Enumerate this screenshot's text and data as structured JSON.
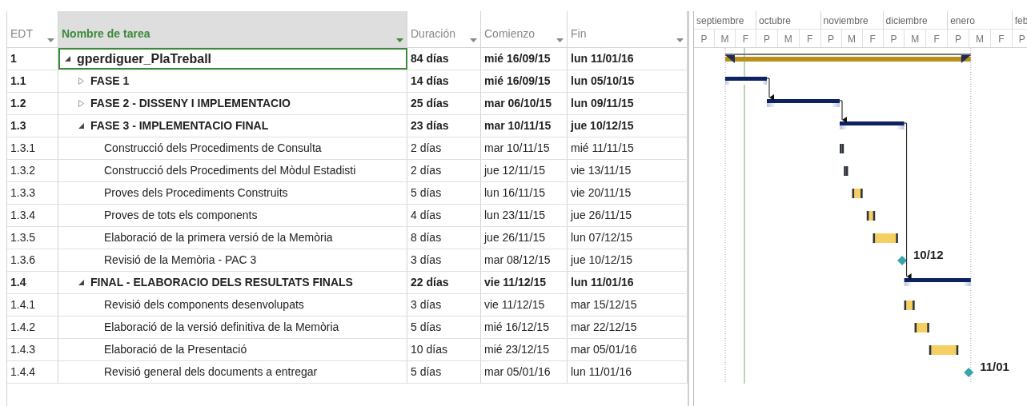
{
  "columns": [
    {
      "label": "EDT",
      "selected": false
    },
    {
      "label": "Nombre de tarea",
      "selected": true
    },
    {
      "label": "Duración",
      "selected": false
    },
    {
      "label": "Comienzo",
      "selected": false
    },
    {
      "label": "Fin",
      "selected": false
    }
  ],
  "timescale": {
    "months": [
      {
        "label": "septiembre",
        "periods": [
          "P",
          "M",
          "F"
        ]
      },
      {
        "label": "octubre",
        "periods": [
          "P",
          "M",
          "F"
        ]
      },
      {
        "label": "noviembre",
        "periods": [
          "P",
          "M",
          "F"
        ]
      },
      {
        "label": "diciembre",
        "periods": [
          "P",
          "M",
          "F"
        ]
      },
      {
        "label": "enero",
        "periods": [
          "P",
          "M",
          "F"
        ]
      },
      {
        "label": "feb",
        "periods": [
          "P"
        ]
      }
    ]
  },
  "tasks": [
    {
      "edt": "1",
      "name": "gperdiguer_PlaTreball",
      "duration": "84 días",
      "start": "mié 16/09/15",
      "finish": "lun 11/01/16",
      "kind": "project",
      "expanded": true,
      "selected": true,
      "children": [
        {
          "edt": "1.1",
          "name": "FASE 1",
          "duration": "14 días",
          "start": "mié 16/09/15",
          "finish": "lun 05/10/15",
          "kind": "summary",
          "expanded": false,
          "selected": false,
          "links_to_next": true
        },
        {
          "edt": "1.2",
          "name": "FASE 2 - DISSENY I IMPLEMENTACIO",
          "duration": "25 días",
          "start": "mar 06/10/15",
          "finish": "lun 09/11/15",
          "kind": "summary",
          "expanded": false,
          "selected": false,
          "links_to_next": true
        },
        {
          "edt": "1.3",
          "name": "FASE 3 - IMPLEMENTACIO FINAL",
          "duration": "23 días",
          "start": "mar 10/11/15",
          "finish": "jue 10/12/15",
          "kind": "summary",
          "expanded": true,
          "selected": false,
          "links_to_next": true,
          "children": [
            {
              "edt": "1.3.1",
              "name": "Construcció dels Procediments de Consulta",
              "duration": "2 días",
              "start": "mar 10/11/15",
              "finish": "mié 11/11/15",
              "kind": "task",
              "selected": false
            },
            {
              "edt": "1.3.2",
              "name": "Construcció dels Procediments del Mòdul Estadisti",
              "duration": "2 días",
              "start": "jue 12/11/15",
              "finish": "vie 13/11/15",
              "kind": "task",
              "selected": false
            },
            {
              "edt": "1.3.3",
              "name": "Proves dels Procediments Construits",
              "duration": "5 días",
              "start": "lun 16/11/15",
              "finish": "vie 20/11/15",
              "kind": "task",
              "selected": false
            },
            {
              "edt": "1.3.4",
              "name": "Proves de tots els components",
              "duration": "4 días",
              "start": "lun 23/11/15",
              "finish": "jue 26/11/15",
              "kind": "task",
              "selected": false
            },
            {
              "edt": "1.3.5",
              "name": "Elaboració de la primera versió de la Memòria",
              "duration": "8 días",
              "start": "jue 26/11/15",
              "finish": "lun 07/12/15",
              "kind": "task",
              "selected": false
            },
            {
              "edt": "1.3.6",
              "name": "Revisió de la Memòria - PAC 3",
              "duration": "3 días",
              "start": "mar 08/12/15",
              "finish": "jue 10/12/15",
              "kind": "milestone",
              "bar_label": "10/12",
              "selected": false
            }
          ]
        },
        {
          "edt": "1.4",
          "name": "FINAL - ELABORACIO DELS RESULTATS FINALS",
          "duration": "22 días",
          "start": "vie 11/12/15",
          "finish": "lun 11/01/16",
          "kind": "summary",
          "expanded": true,
          "selected": false,
          "children": [
            {
              "edt": "1.4.1",
              "name": "Revisió dels components desenvolupats",
              "duration": "3 días",
              "start": "vie 11/12/15",
              "finish": "mar 15/12/15",
              "kind": "task",
              "selected": false
            },
            {
              "edt": "1.4.2",
              "name": "Elaboració de la versió definitiva de la Memòria",
              "duration": "5 días",
              "start": "mié 16/12/15",
              "finish": "mar 22/12/15",
              "kind": "task",
              "selected": false
            },
            {
              "edt": "1.4.3",
              "name": "Elaboració de la Presentació",
              "duration": "10 días",
              "start": "mié 23/12/15",
              "finish": "mar 05/01/16",
              "kind": "task",
              "selected": false
            },
            {
              "edt": "1.4.4",
              "name": "Revisió general dels documents a entregar",
              "duration": "5 días",
              "start": "mar 05/01/16",
              "finish": "lun 11/01/16",
              "kind": "milestone",
              "bar_label": "11/01",
              "selected": false
            }
          ]
        }
      ]
    }
  ]
}
